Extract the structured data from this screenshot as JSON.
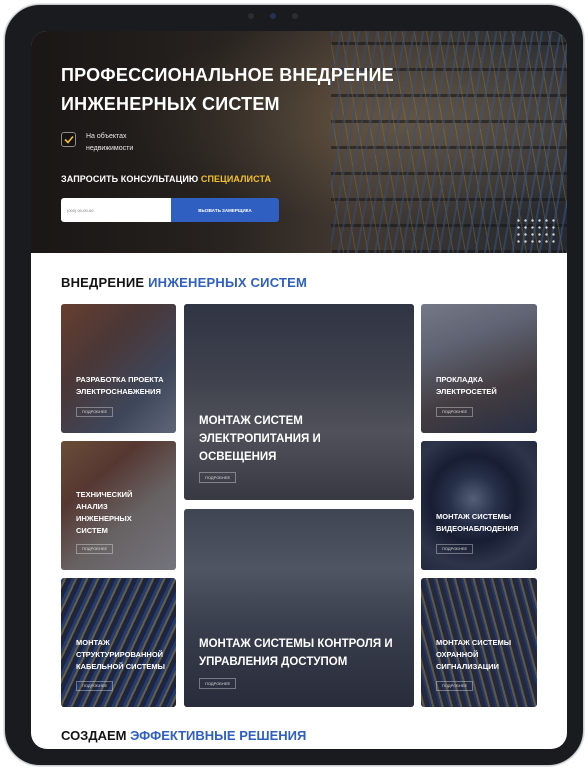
{
  "hero": {
    "title_line1": "ПРОФЕССИОНАЛЬНОЕ ВНЕДРЕНИЕ",
    "title_line2": "ИНЖЕНЕРНЫХ СИСТЕМ",
    "check_line1": "На объектах",
    "check_line2": "недвижимости",
    "cta_part1": "ЗАПРОСИТЬ КОНСУЛЬТАЦИЮ ",
    "cta_part2": "СПЕЦИАЛИСТА",
    "phone_placeholder": "(000) 00-00-00",
    "call_button": "ВЫЗВАТЬ ЗАМЕРЩИКА"
  },
  "section": {
    "title_part1": "ВНЕДРЕНИЕ ",
    "title_part2": "ИНЖЕНЕРНЫХ СИСТЕМ"
  },
  "cards": [
    {
      "lines": [
        "РАЗРАБОТКА ПРОЕКТА",
        "ЭЛЕКТРОСНАБЖЕНИЯ"
      ],
      "more": "ПОДРОБНЕЕ"
    },
    {
      "lines": [
        "МОНТАЖ СИСТЕМ",
        "ЭЛЕКТРОПИТАНИЯ И",
        "ОСВЕЩЕНИЯ"
      ],
      "more": "ПОДРОБНЕЕ"
    },
    {
      "lines": [
        "ПРОКЛАДКА",
        "ЭЛЕКТРОСЕТЕЙ"
      ],
      "more": "ПОДРОБНЕЕ"
    },
    {
      "lines": [
        "ТЕХНИЧЕСКИЙ",
        "АНАЛИЗ",
        "ИНЖЕНЕРНЫХ",
        "СИСТЕМ"
      ],
      "more": "ПОДРОБНЕЕ"
    },
    {
      "lines": [
        "МОНТАЖ СИСТЕМЫ",
        "ВИДЕОНАБЛЮДЕНИЯ"
      ],
      "more": "ПОДРОБНЕЕ"
    },
    {
      "lines": [
        "МОНТАЖ",
        "СТРУКТУРИРОВАННОЙ",
        "КАБЕЛЬНОЙ СИСТЕМЫ"
      ],
      "more": "ПОДРОБНЕЕ"
    },
    {
      "lines": [
        "МОНТАЖ СИСТЕМЫ КОНТРОЛЯ И",
        "УПРАВЛЕНИЯ ДОСТУПОМ"
      ],
      "more": "ПОДРОБНЕЕ"
    },
    {
      "lines": [
        "МОНТАЖ СИСТЕМЫ",
        "ОХРАННОЙ",
        "СИГНАЛИЗАЦИИ"
      ],
      "more": "ПОДРОБНЕЕ"
    }
  ],
  "bottom": {
    "title_part1": "СОЗДАЕМ ",
    "title_part2": "ЭФФЕКТИВНЫЕ РЕШЕНИЯ"
  },
  "colors": {
    "accent_blue": "#2f5fc1",
    "accent_yellow": "#f4c12b",
    "card_overlay": "#161b34"
  }
}
